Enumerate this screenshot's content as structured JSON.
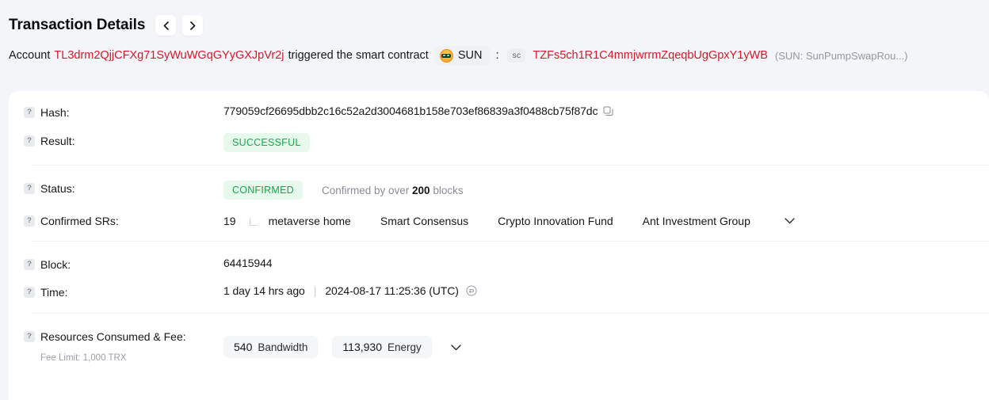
{
  "header": {
    "title": "Transaction Details",
    "prev_label": "‹",
    "next_label": "›"
  },
  "summary": {
    "prefix": "Account",
    "account_address": "TL3drm2QjjCFXg71SyWuWGqGYyGXJpVr2j",
    "middle": "triggered the smart contract",
    "token_label": "SUN",
    "colon": ":",
    "sc_badge": "sc",
    "contract_address": "TZFs5ch1R1C4mmjwrrmZqeqbUgGpxY1yWB",
    "contract_note": "(SUN: SunPumpSwapRou...)"
  },
  "details": {
    "hash": {
      "label": "Hash:",
      "value": "779059cf26695dbb2c16c52a2d3004681b158e703ef86839a3f0488cb75f87dc"
    },
    "result": {
      "label": "Result:",
      "badge": "SUCCESSFUL"
    },
    "status": {
      "label": "Status:",
      "badge": "CONFIRMED",
      "note_prefix": "Confirmed by over",
      "note_count": "200",
      "note_suffix": "blocks"
    },
    "confirmed_srs": {
      "label": "Confirmed SRs:",
      "count": "19",
      "names": [
        "metaverse home",
        "Smart Consensus",
        "Crypto Innovation Fund",
        "Ant Investment Group"
      ]
    },
    "block": {
      "label": "Block:",
      "value": "64415944"
    },
    "time": {
      "label": "Time:",
      "relative": "1 day 14 hrs ago",
      "separator": "|",
      "absolute": "2024-08-17 11:25:36 (UTC)"
    },
    "resources": {
      "label": "Resources Consumed & Fee:",
      "sub_label": "Fee Limit: 1,000 TRX",
      "bandwidth_value": "540",
      "bandwidth_unit": "Bandwidth",
      "energy_value": "113,930",
      "energy_unit": "Energy"
    }
  },
  "colors": {
    "page_bg": "#f4f5f8",
    "card_bg": "#ffffff",
    "link_red": "#d7182a",
    "success_green": "#19a84b",
    "confirmed_green": "#0fa84c",
    "badge_bg_green": "#e7f8ed",
    "muted_text": "#8a8d95"
  },
  "icons": {
    "help": "?",
    "copy": "copy-icon",
    "refresh": "refresh-icon",
    "chevron_down": "chevron-down-icon",
    "chevron_left": "chevron-left-icon",
    "chevron_right": "chevron-right-icon"
  }
}
